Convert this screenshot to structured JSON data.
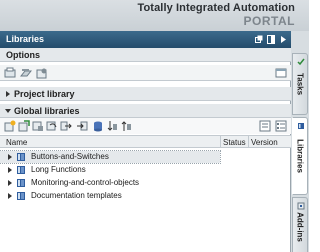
{
  "banner": {
    "title": "Totally Integrated Automation",
    "subtitle": "PORTAL"
  },
  "panel": {
    "title": "Libraries",
    "options": {
      "title": "Options"
    },
    "project_library": {
      "title": "Project library"
    },
    "global_libraries": {
      "title": "Global libraries"
    },
    "table": {
      "columns": {
        "name": "Name",
        "status": "Status",
        "version": "Version"
      },
      "rows": [
        {
          "name": "Buttons-and-Switches",
          "selected": true
        },
        {
          "name": "Long Functions"
        },
        {
          "name": "Monitoring-and-control-objects"
        },
        {
          "name": "Documentation templates"
        }
      ]
    }
  },
  "side_tabs": [
    {
      "label": "Tasks",
      "icon": "tasks-icon"
    },
    {
      "label": "Libraries",
      "icon": "libraries-icon",
      "active": true
    },
    {
      "label": "Add-ins",
      "icon": "add-ins-icon"
    }
  ]
}
